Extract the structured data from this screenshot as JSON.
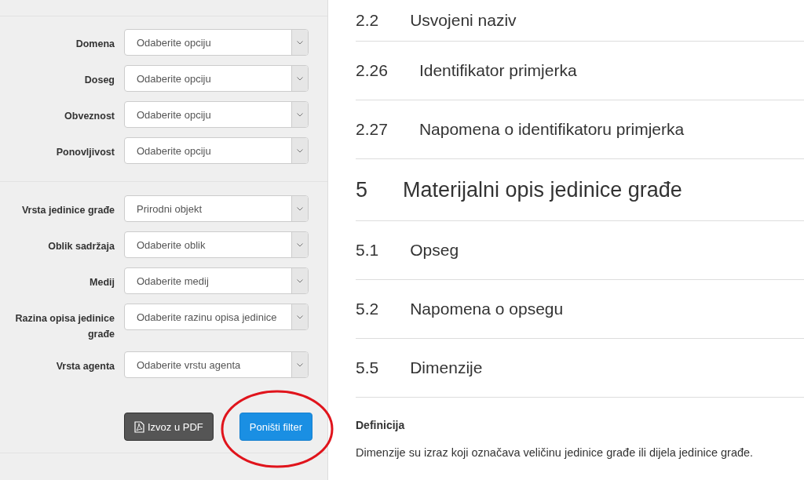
{
  "filter_groups": [
    {
      "fields": [
        {
          "label": "Domena",
          "value": "Odaberite opciju"
        },
        {
          "label": "Doseg",
          "value": "Odaberite opciju"
        },
        {
          "label": "Obveznost",
          "value": "Odaberite opciju"
        },
        {
          "label": "Ponovljivost",
          "value": "Odaberite opciju"
        }
      ]
    },
    {
      "fields": [
        {
          "label": "Vrsta jedinice građe",
          "value": "Prirodni objekt"
        },
        {
          "label": "Oblik sadržaja",
          "value": "Odaberite oblik"
        },
        {
          "label": "Medij",
          "value": "Odaberite medij"
        },
        {
          "label": "Razina opisa jedinice građe",
          "value": "Odaberite razinu opisa jedinice"
        },
        {
          "label": "Vrsta agenta",
          "value": "Odaberite vrstu agenta"
        }
      ]
    }
  ],
  "buttons": [
    {
      "kind": "export",
      "label": "Izvoz u PDF"
    },
    {
      "kind": "reset",
      "label": "Poništi filter"
    }
  ],
  "headings": [
    {
      "kind": "section",
      "number": "2.2",
      "title": "Usvojeni naziv"
    },
    {
      "kind": "section",
      "number": "2.26",
      "title": "Identifikator primjerka"
    },
    {
      "kind": "section",
      "number": "2.27",
      "title": "Napomena o identifikatoru primjerka"
    },
    {
      "kind": "chapter",
      "number": "5",
      "title": "Materijalni opis jedinice građe"
    },
    {
      "kind": "section",
      "number": "5.1",
      "title": "Opseg"
    },
    {
      "kind": "section",
      "number": "5.2",
      "title": "Napomena o opsegu"
    },
    {
      "kind": "section",
      "number": "5.5",
      "title": "Dimenzije"
    }
  ],
  "definition": {
    "title": "Definicija",
    "text": "Dimenzije su izraz koji označava veličinu jedinice građe ili dijela jedinice građe."
  }
}
